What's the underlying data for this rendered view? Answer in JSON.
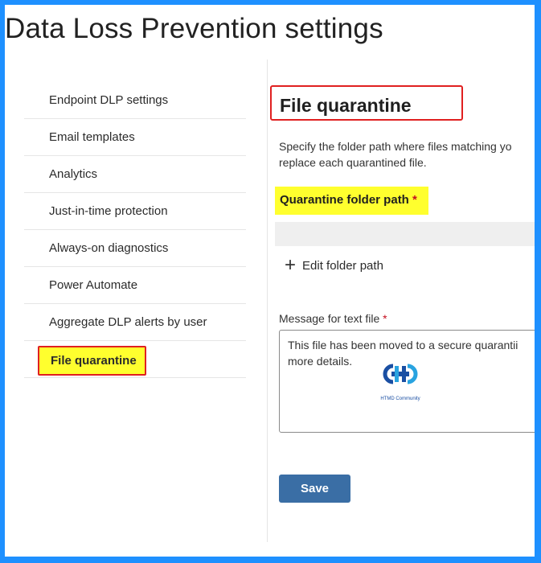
{
  "page": {
    "title": "Data Loss Prevention settings"
  },
  "nav": {
    "items": [
      {
        "label": "Endpoint DLP settings"
      },
      {
        "label": "Email templates"
      },
      {
        "label": "Analytics"
      },
      {
        "label": "Just-in-time protection"
      },
      {
        "label": "Always-on diagnostics"
      },
      {
        "label": "Power Automate"
      },
      {
        "label": "Aggregate DLP alerts by user"
      },
      {
        "label": "File quarantine",
        "active": true
      }
    ]
  },
  "content": {
    "title": "File quarantine",
    "description_line1": "Specify the folder path where files matching yo",
    "description_line2": "replace each quarantined file.",
    "folder_label": "Quarantine folder path",
    "required_mark": "*",
    "edit_folder_label": "Edit folder path",
    "message_label": "Message for text file",
    "message_line1": "This file has been moved to a secure quarantii",
    "message_line2": "more details.",
    "save_label": "Save"
  },
  "watermark": {
    "caption": "HTMD Community"
  },
  "colors": {
    "accent": "#3a6ea5",
    "highlight": "#ffff2e",
    "annotation": "#e02020",
    "frame": "#1e90ff"
  }
}
